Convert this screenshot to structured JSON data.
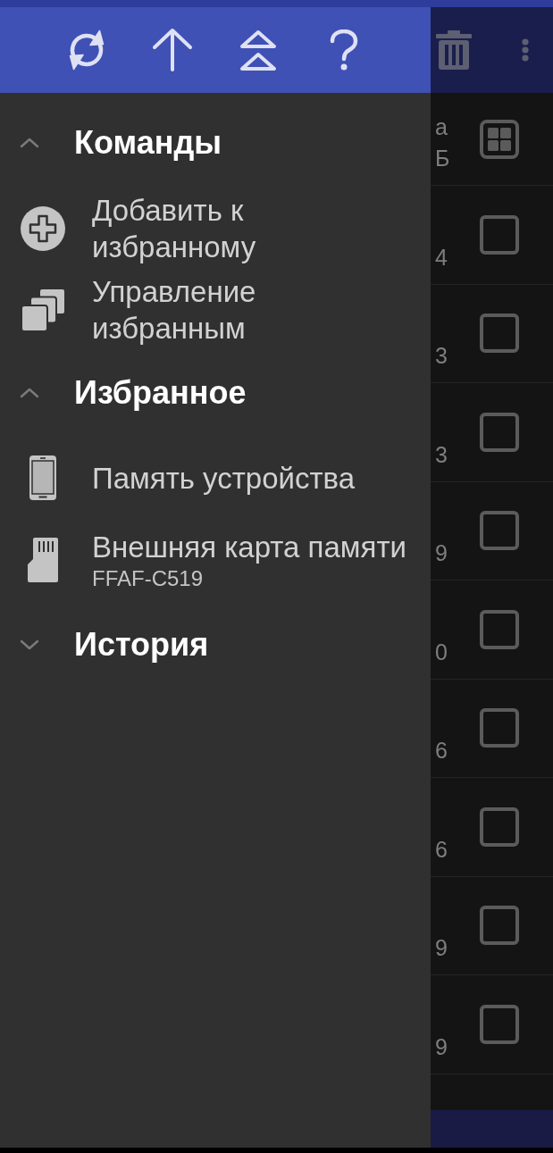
{
  "drawer": {
    "sections": [
      {
        "title": "Команды",
        "expanded": true,
        "items": [
          {
            "label": "Добавить к избранному"
          },
          {
            "label": "Управление избранным"
          }
        ]
      },
      {
        "title": "Избранное",
        "expanded": true,
        "items": [
          {
            "label": "Память устройства"
          },
          {
            "label": "Внешняя карта памяти",
            "subtitle": "FFAF-C519"
          }
        ]
      },
      {
        "title": "История",
        "expanded": false
      }
    ]
  },
  "file_list": {
    "rows": [
      {
        "kind": "tile",
        "line_1": "а",
        "line_2": "Б"
      },
      {
        "kind": "checkbox",
        "checked": false,
        "line_2": "4"
      },
      {
        "kind": "checkbox",
        "checked": false,
        "line_2": "3"
      },
      {
        "kind": "checkbox",
        "checked": false,
        "line_2": "3"
      },
      {
        "kind": "checkbox",
        "checked": false,
        "line_2": "9"
      },
      {
        "kind": "checkbox",
        "checked": false,
        "line_2": "0"
      },
      {
        "kind": "checkbox",
        "checked": false,
        "line_2": "6"
      },
      {
        "kind": "checkbox",
        "checked": false,
        "line_2": "6"
      },
      {
        "kind": "checkbox",
        "checked": false,
        "line_2": "9"
      },
      {
        "kind": "checkbox",
        "checked": false,
        "line_2": "9"
      }
    ]
  }
}
